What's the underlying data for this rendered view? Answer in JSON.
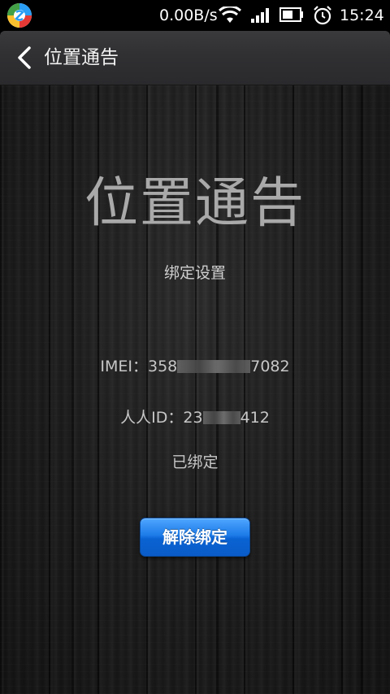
{
  "status_bar": {
    "net_speed": "0.00B/s",
    "time": "15:24",
    "icons": [
      "app-logo-icon",
      "wifi-icon",
      "signal-icon",
      "battery-icon",
      "alarm-icon"
    ]
  },
  "title_bar": {
    "back_icon": "chevron-left-icon",
    "title": "位置通告"
  },
  "main": {
    "heading": "位置通告",
    "subtitle": "绑定设置",
    "imei_prefix": "IMEI：358",
    "imei_suffix": "7082",
    "renren_prefix": "人人ID：23",
    "renren_suffix": "412",
    "bound_status": "已绑定",
    "unbind_button": "解除绑定"
  },
  "colors": {
    "button_blue": "#1d7be8",
    "title_bar_bg": "#303033",
    "text_gray": "#a9a9a9"
  }
}
